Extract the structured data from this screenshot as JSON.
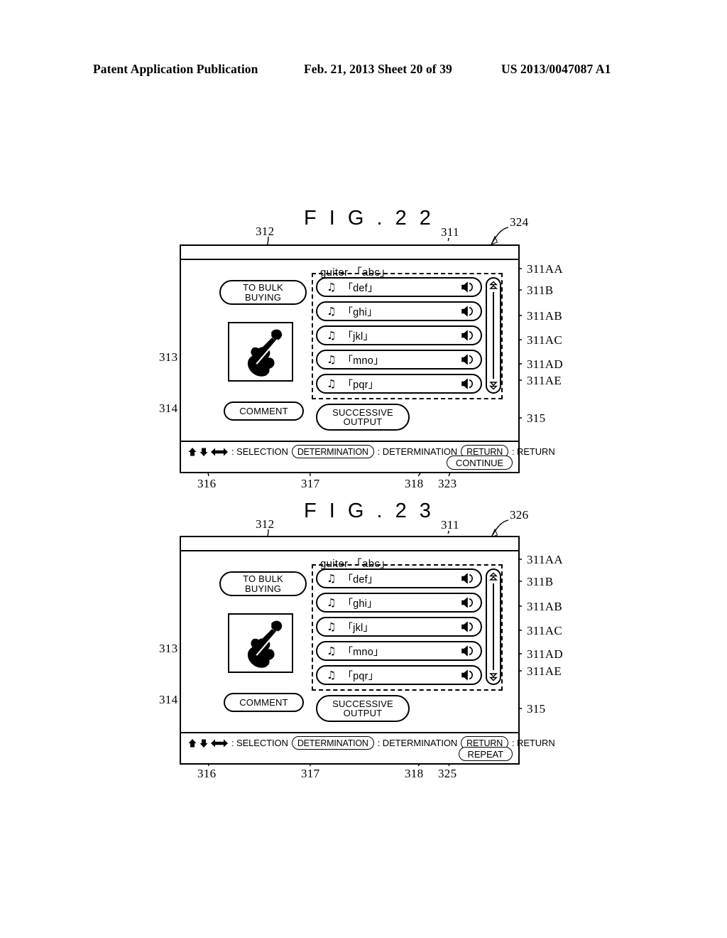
{
  "patent_header": {
    "publication": "Patent Application Publication",
    "date_sheet": "Feb. 21, 2013  Sheet 20 of 39",
    "number": "US 2013/0047087 A1"
  },
  "figures": [
    {
      "title": "F I G . 2 2",
      "screen_ref": "324",
      "caption": "guiter 「abc」",
      "bulk_buying_label": "TO BULK\nBUYING",
      "bulk_buying_line1": "TO BULK",
      "bulk_buying_line2": "BUYING",
      "comment_label": "COMMENT",
      "successive_output_line1": "SUCCESSIVE",
      "successive_output_line2": "OUTPUT",
      "thumbnail_icon": "guitar-icon",
      "tracks": [
        {
          "note_icon": "music-note-icon",
          "name": "「def」",
          "speaker_icon": "speaker-icon",
          "ref": "311AA"
        },
        {
          "note_icon": "music-note-icon",
          "name": "「ghi」",
          "speaker_icon": "speaker-icon",
          "ref": "311AB"
        },
        {
          "note_icon": "music-note-icon",
          "name": "「jkl」",
          "speaker_icon": "speaker-icon",
          "ref": "311AC"
        },
        {
          "note_icon": "music-note-icon",
          "name": "「mno」",
          "speaker_icon": "speaker-icon",
          "ref": "311AD"
        },
        {
          "note_icon": "music-note-icon",
          "name": "「pqr」",
          "speaker_icon": "speaker-icon",
          "ref": "311AE"
        }
      ],
      "statusbar": {
        "selection_label": ": SELECTION",
        "determination_key": "DETERMINATION",
        "determination_label": ": DETERMINATION",
        "return_key": "RETURN",
        "return_label": ": RETURN",
        "action_button": "CONTINUE"
      },
      "refs": {
        "to_bulk_buying": "312",
        "list_area": "311",
        "screen": "324",
        "thumbnail": "313",
        "comment": "314",
        "successive_output": "315",
        "selection_keys": "316",
        "determination_key": "317",
        "return_key": "318",
        "action_button": "323",
        "scrollbar": "311B",
        "track_refs": [
          "311AA",
          "311B",
          "311AB",
          "311AC",
          "311AD",
          "311AE"
        ]
      }
    },
    {
      "title": "F I G . 2 3",
      "screen_ref": "326",
      "caption": "guiter 「abc」",
      "bulk_buying_line1": "TO BULK",
      "bulk_buying_line2": "BUYING",
      "comment_label": "COMMENT",
      "successive_output_line1": "SUCCESSIVE",
      "successive_output_line2": "OUTPUT",
      "thumbnail_icon": "guitar-icon",
      "tracks": [
        {
          "note_icon": "music-note-icon",
          "name": "「def」",
          "speaker_icon": "speaker-icon",
          "ref": "311AA"
        },
        {
          "note_icon": "music-note-icon",
          "name": "「ghi」",
          "speaker_icon": "speaker-icon",
          "ref": "311AB"
        },
        {
          "note_icon": "music-note-icon",
          "name": "「jkl」",
          "speaker_icon": "speaker-icon",
          "ref": "311AC"
        },
        {
          "note_icon": "music-note-icon",
          "name": "「mno」",
          "speaker_icon": "speaker-icon",
          "ref": "311AD"
        },
        {
          "note_icon": "music-note-icon",
          "name": "「pqr」",
          "speaker_icon": "speaker-icon",
          "ref": "311AE"
        }
      ],
      "statusbar": {
        "selection_label": ": SELECTION",
        "determination_key": "DETERMINATION",
        "determination_label": ": DETERMINATION",
        "return_key": "RETURN",
        "return_label": ": RETURN",
        "action_button": "REPEAT"
      },
      "refs": {
        "to_bulk_buying": "312",
        "list_area": "311",
        "screen": "326",
        "thumbnail": "313",
        "comment": "314",
        "successive_output": "315",
        "selection_keys": "316",
        "determination_key": "317",
        "return_key": "318",
        "action_button": "325",
        "scrollbar": "311B",
        "track_refs": [
          "311AA",
          "311B",
          "311AB",
          "311AC",
          "311AD",
          "311AE"
        ]
      }
    }
  ]
}
